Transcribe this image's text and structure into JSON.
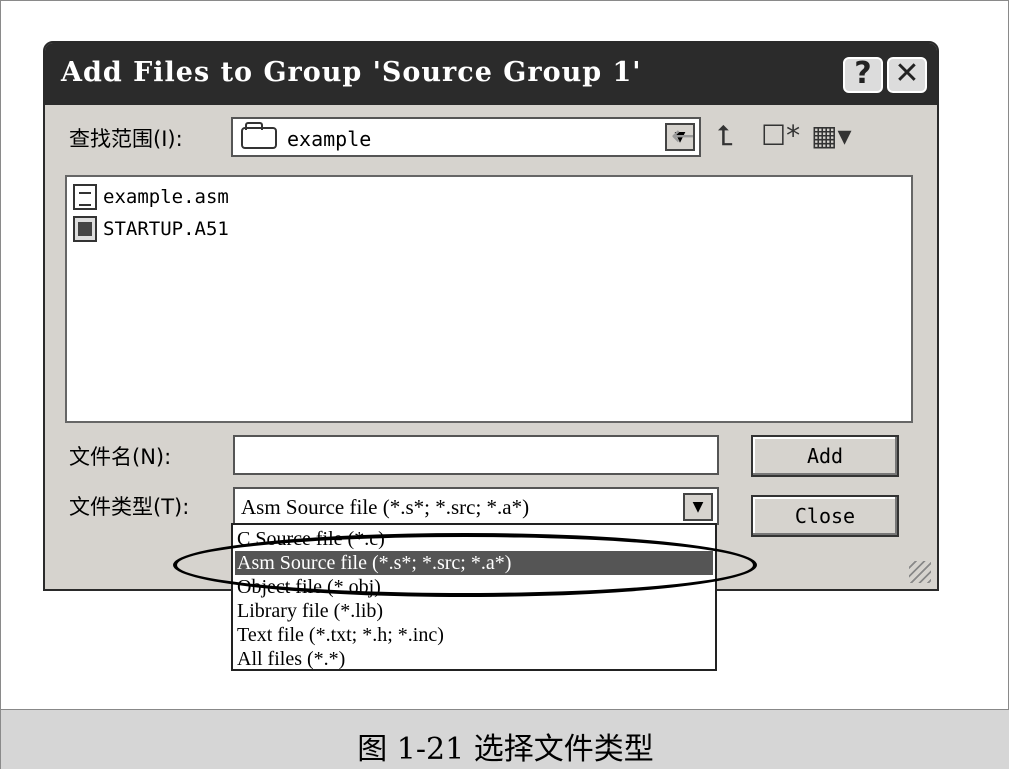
{
  "dialog": {
    "title": "Add Files to Group 'Source Group 1'",
    "help_label": "?",
    "close_label": "✕"
  },
  "lookin": {
    "label": "查找范围(I):",
    "value": "example"
  },
  "toolbar": {
    "back_icon": "←",
    "up_icon": "⮤",
    "new_folder_icon": "☐*",
    "view_icon": "▦▾"
  },
  "files": [
    {
      "name": "example.asm",
      "icon": "document-icon"
    },
    {
      "name": "STARTUP.A51",
      "icon": "executable-icon"
    }
  ],
  "filename": {
    "label": "文件名(N):",
    "value": ""
  },
  "filetype": {
    "label": "文件类型(T):",
    "value": "Asm Source file (*.s*; *.src; *.a*)",
    "options": [
      "C Source file (*.c)",
      "Asm Source file (*.s*; *.src; *.a*)",
      "Object file (*.obj)",
      "Library file (*.lib)",
      "Text file (*.txt; *.h; *.inc)",
      "All files (*.*)"
    ],
    "selected_index": 1
  },
  "buttons": {
    "add": "Add",
    "close": "Close"
  },
  "caption": "图 1-21  选择文件类型"
}
